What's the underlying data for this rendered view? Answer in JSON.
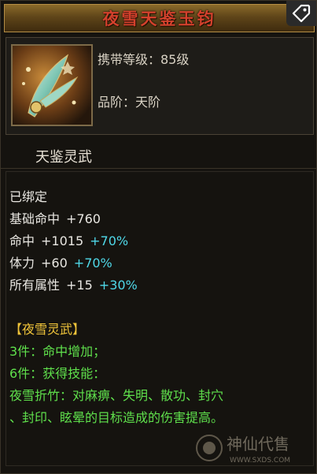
{
  "item": {
    "title": "夜雪天鉴玉钧",
    "level_label": "携带等级：85级",
    "grade_label": "品阶：天阶",
    "type_name": "天鉴灵武"
  },
  "stats": {
    "bound": "已绑定",
    "base_hit": {
      "label": "基础命中",
      "value": "+760"
    },
    "hit": {
      "label": "命中",
      "value": "+1015",
      "bonus": "+70%"
    },
    "stamina": {
      "label": "体力",
      "value": "+60",
      "bonus": "+70%"
    },
    "all_attr": {
      "label": "所有属性",
      "value": "+15",
      "bonus": "+30%"
    }
  },
  "set": {
    "name": "【夜雪灵武】",
    "piece3": "3件：命中增加；",
    "piece6": "6件：获得技能：",
    "skill_line1": "夜雪折竹：对麻痹、失明、散功、封穴",
    "skill_line2": "、封印、眩晕的目标造成的伤害提高。"
  },
  "watermark": {
    "text_cn": "神仙代售",
    "text_en": "WWW.SXDS.COM"
  },
  "colors": {
    "title": "#d3412c",
    "cyan": "#4fd8e8",
    "yellow": "#f0c43a",
    "green": "#5fe04c"
  },
  "icons": [
    "tag-icon",
    "item-weapon-icon",
    "watermark-logo-icon"
  ]
}
